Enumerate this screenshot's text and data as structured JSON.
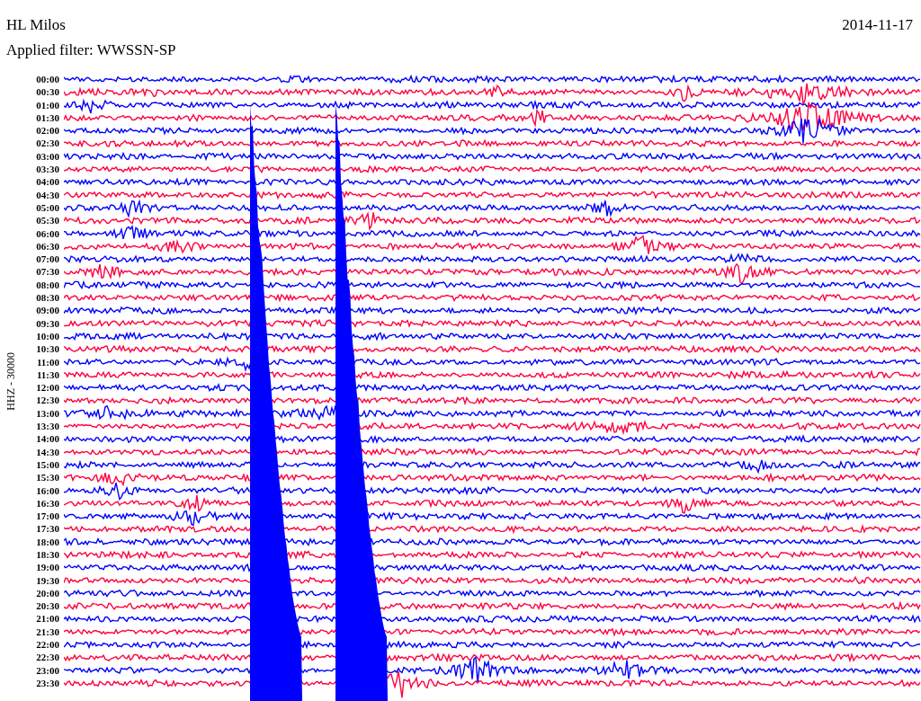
{
  "station": "HL Milos",
  "filter": "Applied filter: WWSSN-SP",
  "date": "2014-11-17",
  "channel_label": "HHZ - 30000",
  "traces": [
    {
      "time": "00:00",
      "color": "#0000ff"
    },
    {
      "time": "00:30",
      "color": "#ff0040"
    },
    {
      "time": "01:00",
      "color": "#0000ff"
    },
    {
      "time": "01:30",
      "color": "#ff0040"
    },
    {
      "time": "02:00",
      "color": "#0000ff"
    },
    {
      "time": "02:30",
      "color": "#ff0040"
    },
    {
      "time": "03:00",
      "color": "#0000ff"
    },
    {
      "time": "03:30",
      "color": "#ff0040"
    },
    {
      "time": "04:00",
      "color": "#0000ff"
    },
    {
      "time": "04:30",
      "color": "#ff0040"
    },
    {
      "time": "05:00",
      "color": "#0000ff"
    },
    {
      "time": "05:30",
      "color": "#ff0040"
    },
    {
      "time": "06:00",
      "color": "#0000ff"
    },
    {
      "time": "06:30",
      "color": "#ff0040"
    },
    {
      "time": "07:00",
      "color": "#0000ff"
    },
    {
      "time": "07:30",
      "color": "#ff0040"
    },
    {
      "time": "08:00",
      "color": "#0000ff"
    },
    {
      "time": "08:30",
      "color": "#ff0040"
    },
    {
      "time": "09:00",
      "color": "#0000ff"
    },
    {
      "time": "09:30",
      "color": "#ff0040"
    },
    {
      "time": "10:00",
      "color": "#0000ff"
    },
    {
      "time": "10:30",
      "color": "#ff0040"
    },
    {
      "time": "11:00",
      "color": "#0000ff"
    },
    {
      "time": "11:30",
      "color": "#ff0040"
    },
    {
      "time": "12:00",
      "color": "#0000ff"
    },
    {
      "time": "12:30",
      "color": "#ff0040"
    },
    {
      "time": "13:00",
      "color": "#0000ff"
    },
    {
      "time": "13:30",
      "color": "#ff0040"
    },
    {
      "time": "14:00",
      "color": "#0000ff"
    },
    {
      "time": "14:30",
      "color": "#ff0040"
    },
    {
      "time": "15:00",
      "color": "#0000ff"
    },
    {
      "time": "15:30",
      "color": "#ff0040"
    },
    {
      "time": "16:00",
      "color": "#0000ff"
    },
    {
      "time": "16:30",
      "color": "#ff0040"
    },
    {
      "time": "17:00",
      "color": "#0000ff"
    },
    {
      "time": "17:30",
      "color": "#ff0040"
    },
    {
      "time": "18:00",
      "color": "#0000ff"
    },
    {
      "time": "18:30",
      "color": "#ff0040"
    },
    {
      "time": "19:00",
      "color": "#0000ff"
    },
    {
      "time": "19:30",
      "color": "#ff0040"
    },
    {
      "time": "20:00",
      "color": "#0000ff"
    },
    {
      "time": "20:30",
      "color": "#ff0040"
    },
    {
      "time": "21:00",
      "color": "#0000ff"
    },
    {
      "time": "21:30",
      "color": "#ff0040"
    },
    {
      "time": "22:00",
      "color": "#0000ff"
    },
    {
      "time": "22:30",
      "color": "#ff0040"
    },
    {
      "time": "23:00",
      "color": "#0000ff"
    },
    {
      "time": "23:30",
      "color": "#ff0040"
    }
  ]
}
